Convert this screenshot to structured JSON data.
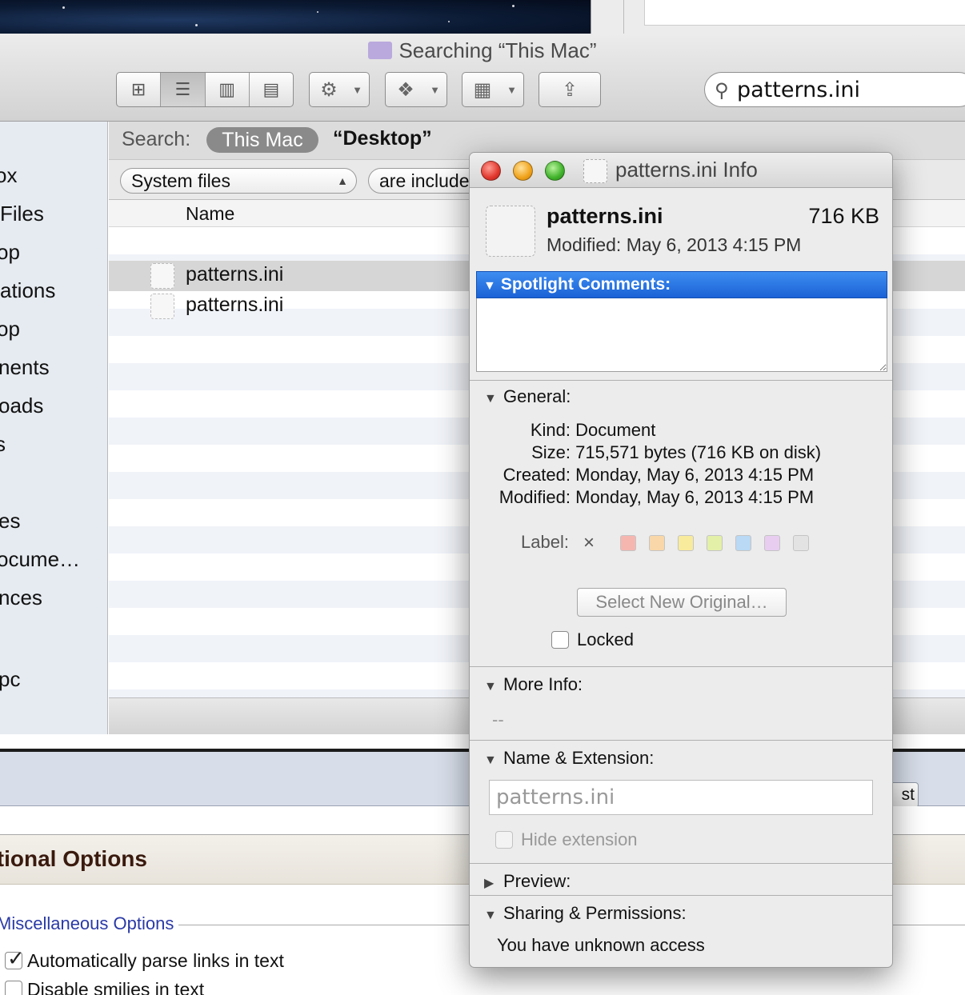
{
  "finder": {
    "title": "Searching “This Mac”",
    "search_value": "patterns.ini",
    "sidebar_items": [
      "ox",
      " Files",
      "op",
      "ations",
      "op",
      "nents",
      "oads",
      "s",
      "es",
      "ocume…",
      "nces",
      "pc"
    ],
    "scope_label": "Search:",
    "scope_active": "This Mac",
    "scope_other": "“Desktop”",
    "criteria_kind": "System files",
    "criteria_op": "are include",
    "column_name": "Name",
    "rows": [
      "patterns.ini",
      "patterns.ini"
    ]
  },
  "info": {
    "window_title": "patterns.ini Info",
    "file_name": "patterns.ini",
    "file_size": "716 KB",
    "modified_short": "Modified: May 6, 2013 4:15 PM",
    "spotlight_header": "Spotlight Comments:",
    "general_header": "General:",
    "kind_key": "Kind:",
    "kind_val": "Document",
    "size_key": "Size:",
    "size_val": "715,571 bytes (716 KB on disk)",
    "created_key": "Created:",
    "created_val": "Monday, May 6, 2013 4:15 PM",
    "modified_key": "Modified:",
    "modified_val": "Monday, May 6, 2013 4:15 PM",
    "label_key": "Label:",
    "label_none": "×",
    "label_colors": [
      "#f6b6b0",
      "#f9d7a8",
      "#f8eb9c",
      "#e3f0a8",
      "#b9d9f5",
      "#e8cdf1",
      "#e3e3e3"
    ],
    "select_original": "Select New Original…",
    "locked_label": "Locked",
    "more_info_header": "More Info:",
    "more_info_val": "--",
    "name_ext_header": "Name & Extension:",
    "name_ext_value": "patterns.ini",
    "hide_ext_label": "Hide extension",
    "preview_header": "Preview:",
    "sharing_header": "Sharing & Permissions:",
    "access_text": "You have unknown access"
  },
  "page": {
    "button_fragment": "st",
    "section_title": "itional Options",
    "legend": "Miscellaneous Options",
    "opt1": "Automatically parse links in text",
    "opt2": "Disable smilies in text"
  },
  "colors": {
    "selection_blue": "#1a62d6",
    "legend_blue": "#2a3aa6",
    "section_brown": "#3a1a0e"
  }
}
